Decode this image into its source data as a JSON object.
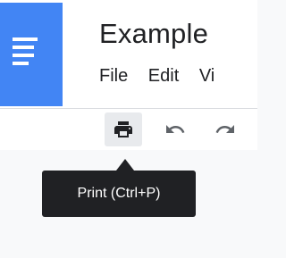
{
  "app": {
    "icon": "docs-app-icon",
    "brand_color": "#4285f4"
  },
  "document": {
    "title": "Example"
  },
  "menu": {
    "items": [
      {
        "label": "File"
      },
      {
        "label": "Edit"
      },
      {
        "label": "Vi"
      }
    ]
  },
  "toolbar": {
    "print_icon": "print-icon",
    "undo_icon": "undo-icon",
    "redo_icon": "redo-icon"
  },
  "tooltip": {
    "text": "Print (Ctrl+P)"
  }
}
